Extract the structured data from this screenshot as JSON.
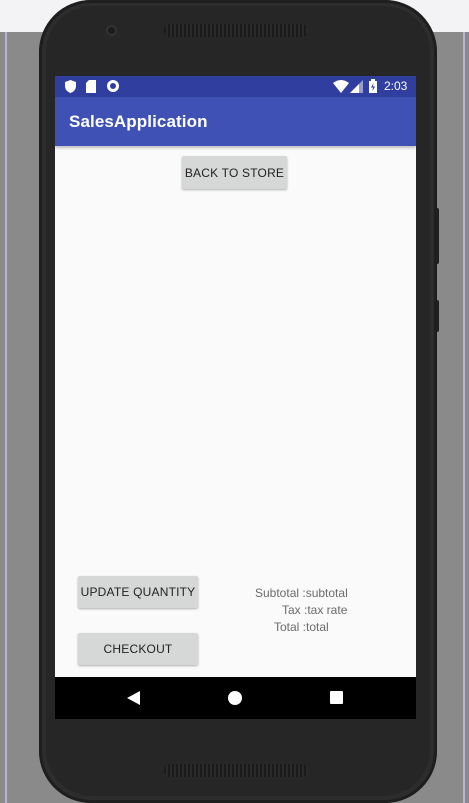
{
  "status_bar": {
    "time": "2:03",
    "icons": [
      "shield-icon",
      "sd-card-icon",
      "circle-notification-icon",
      "wifi-icon",
      "cell-signal-icon",
      "battery-charging-icon"
    ]
  },
  "app_bar": {
    "title": "SalesApplication"
  },
  "buttons": {
    "back_to_store": "BACK TO STORE",
    "update_quantity": "UPDATE QUANTITY",
    "checkout": "CHECKOUT"
  },
  "totals": {
    "subtotal": "Subtotal :subtotal",
    "tax": "Tax :tax rate",
    "total": "Total :total"
  },
  "nav_bar": {
    "icons": [
      "back-triangle-icon",
      "home-circle-icon",
      "recents-square-icon"
    ]
  },
  "colors": {
    "status_bar": "#303f9f",
    "app_bar": "#3f51b5",
    "screen_bg": "#fafafa",
    "button_bg": "#d6d7d7"
  }
}
